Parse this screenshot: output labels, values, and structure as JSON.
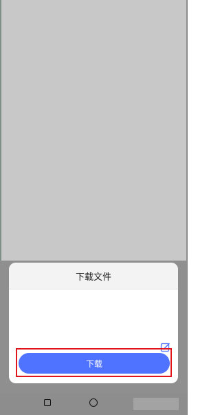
{
  "dialog": {
    "title": "下载文件",
    "download_label": "下载",
    "edit_icon": "edit-icon"
  },
  "navigation": {
    "recents_icon": "square-icon",
    "home_icon": "circle-icon"
  },
  "colors": {
    "accent": "#4f73ff",
    "highlight": "#e0141b",
    "header_background": "#f3f3f3"
  }
}
